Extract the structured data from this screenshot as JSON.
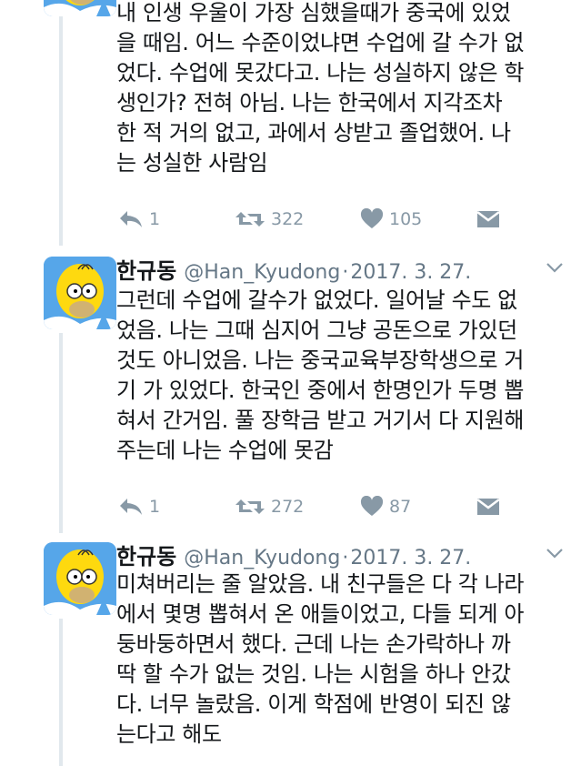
{
  "tweets": [
    {
      "author_name": "",
      "handle": "",
      "date": "",
      "lines": [
        "내 인생 우울이 가장 심했을때가 중국에 있었",
        "을 때임. 어느 수준이었냐면 수업에 갈 수가 없",
        "었다. 수업에 못갔다고. 나는 성실하지 않은 학",
        "생인가? 전혀 아님. 나는 한국에서  지각조차",
        "한 적 거의 없고, 과에서 상받고 졸업했어. 나",
        "는 성실한 사람임"
      ],
      "replies": "1",
      "retweets": "322",
      "likes": "105"
    },
    {
      "author_name": "한규동",
      "handle": "@Han_Kyudong",
      "date": "2017. 3. 27.",
      "lines": [
        "그런데 수업에 갈수가 없었다. 일어날 수도 없",
        "었음. 나는 그때 심지어 그냥 공돈으로 가있던",
        "것도 아니었음. 나는 중국교육부장학생으로 거",
        "기 가 있었다. 한국인 중에서 한명인가 두명 뽑",
        "혀서 간거임. 풀 장학금 받고 거기서 다 지원해",
        "주는데 나는 수업에 못감"
      ],
      "replies": "1",
      "retweets": "272",
      "likes": "87"
    },
    {
      "author_name": "한규동",
      "handle": "@Han_Kyudong",
      "date": "2017. 3. 27.",
      "lines": [
        "미쳐버리는 줄 알았음. 내 친구들은 다 각 나라",
        "에서 몇명 뽑혀서 온 애들이었고, 다들 되게 아",
        "둥바둥하면서 했다. 근데 나는 손가락하나 까",
        "딱 할 수가 없는 것임. 나는 시험을 하나 안갔",
        "다. 너무 놀랐음. 이게 학점에 반영이 되진 않",
        "는다고 해도"
      ]
    }
  ],
  "colors": {
    "text": "#14171a",
    "secondary": "#657786",
    "icon": "#8899a6",
    "thread_line": "#e1e8ed",
    "avatar_bg": "#56a6e9",
    "homer_skin": "#fed90f"
  },
  "icons": {
    "reply": "reply-arrow-icon",
    "retweet": "retweet-icon",
    "like": "heart-icon",
    "dm": "envelope-icon",
    "caret": "chevron-down-icon"
  }
}
